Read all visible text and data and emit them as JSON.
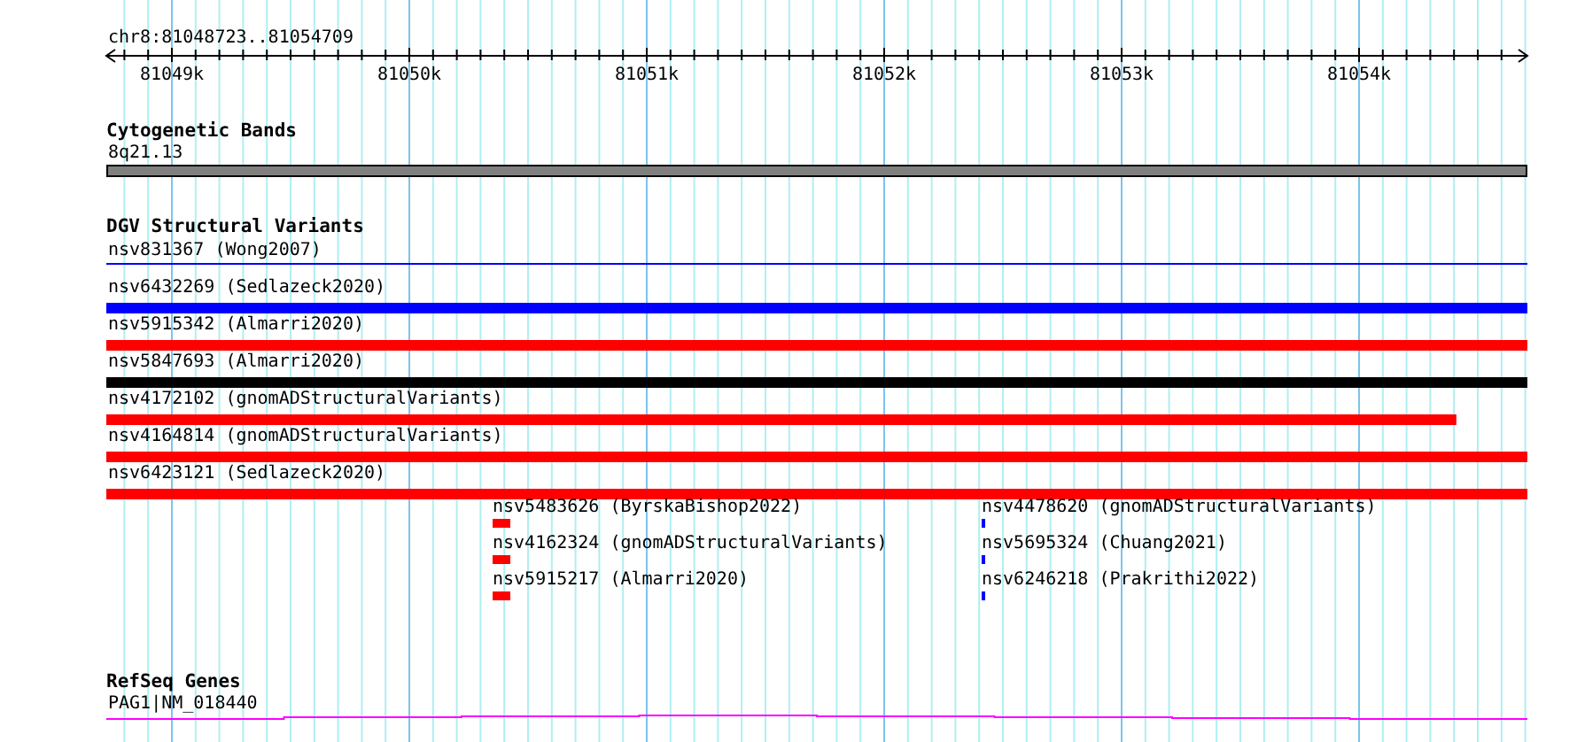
{
  "ruler": {
    "range": "chr8:81048723..81054709",
    "tick_labels": [
      "81049k",
      "81050k",
      "81051k",
      "81052k",
      "81053k",
      "81054k"
    ]
  },
  "tracks": [
    {
      "kind": "bands",
      "title": "Cytogenetic Bands",
      "features": [
        {
          "label": "8q21.13",
          "color": "#808080"
        }
      ]
    },
    {
      "kind": "variants",
      "title": "DGV Structural Variants",
      "features": [
        {
          "label": "nsv831367 (Wong2007)",
          "kind": "line",
          "color": "#0000ff",
          "level": 1
        },
        {
          "label": "nsv6432269 (Sedlazeck2020)",
          "kind": "bar",
          "color": "#0000ff",
          "level": 1
        },
        {
          "label": "nsv5915342 (Almarri2020)",
          "kind": "bar",
          "color": "#ff0000",
          "level": 1
        },
        {
          "label": "nsv5847693 (Almarri2020)",
          "kind": "bar",
          "color": "#000000",
          "level": 1
        },
        {
          "label": "nsv4172102 (gnomADStructuralVariants)",
          "kind": "bar",
          "color": "#ff0000",
          "level": 0.95
        },
        {
          "label": "nsv4164814 (gnomADStructuralVariants)",
          "kind": "bar",
          "color": "#ff0000",
          "level": 1
        },
        {
          "label": "nsv6423121 (Sedlazeck2020)",
          "kind": "bar",
          "color": "#ff0000",
          "level": 1
        }
      ],
      "stacks": [
        {
          "features": [
            {
              "label": "nsv5483626 (ByrskaBishop2022)",
              "kind": "block",
              "color": "#ff0000"
            },
            {
              "label": "nsv4162324 (gnomADStructuralVariants)",
              "kind": "block",
              "color": "#ff0000"
            },
            {
              "label": "nsv5915217 (Almarri2020)",
              "kind": "block",
              "color": "#ff0000"
            }
          ]
        },
        {
          "features": [
            {
              "label": "nsv4478620 (gnomADStructuralVariants)",
              "kind": "tick",
              "color": "#0000ff"
            },
            {
              "label": "nsv5695324 (Chuang2021)",
              "kind": "tick",
              "color": "#0000ff"
            },
            {
              "label": "nsv6246218 (Prakrithi2022)",
              "kind": "tick",
              "color": "#0000ff"
            }
          ]
        }
      ]
    },
    {
      "kind": "gene",
      "title": "RefSeq Genes",
      "features": [
        {
          "label": "PAG1|NM_018440",
          "color": "#ff00ff"
        }
      ]
    }
  ]
}
